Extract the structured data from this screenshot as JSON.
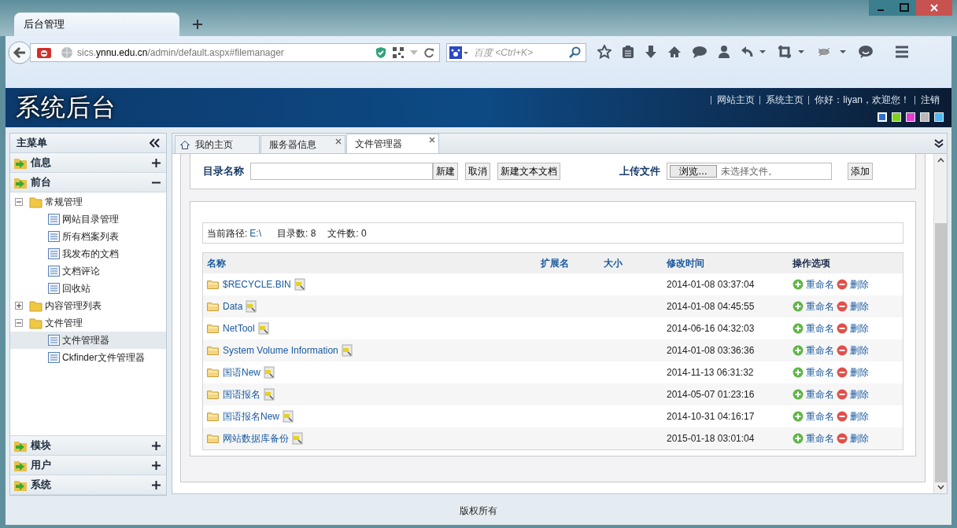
{
  "browser": {
    "tab_title": "后台管理",
    "url": {
      "scheme_host_start": "sics.",
      "host": "ynnu.edu.cn",
      "path": "/admin/default.aspx#filemanager"
    },
    "search_placeholder": "百度 <Ctrl+K>"
  },
  "header": {
    "title": "系统后台",
    "links": [
      "网站主页",
      "系统主页",
      "你好：liyan，欢迎您！",
      "注销"
    ],
    "themes": [
      {
        "color": "#2f6fc8",
        "selected": true
      },
      {
        "color": "#7fd020",
        "selected": false
      },
      {
        "color": "#e040d0",
        "selected": false
      },
      {
        "color": "#b8b8b8",
        "selected": false
      },
      {
        "color": "#50b8f0",
        "selected": false
      }
    ]
  },
  "sidebar": {
    "title": "主菜单",
    "sections": [
      {
        "label": "信息",
        "expanded": false
      },
      {
        "label": "前台",
        "expanded": true,
        "tree": [
          {
            "label": "常规管理",
            "kind": "folder",
            "expanded": true,
            "children": [
              {
                "label": "网站目录管理",
                "kind": "page",
                "selected": false
              },
              {
                "label": "所有档案列表",
                "kind": "page",
                "selected": false
              },
              {
                "label": "我发布的文档",
                "kind": "page",
                "selected": false
              },
              {
                "label": "文档评论",
                "kind": "page",
                "selected": false
              },
              {
                "label": "回收站",
                "kind": "page",
                "selected": false
              }
            ]
          },
          {
            "label": "内容管理列表",
            "kind": "folder",
            "expanded": false
          },
          {
            "label": "文件管理",
            "kind": "folder",
            "expanded": true,
            "children": [
              {
                "label": "文件管理器",
                "kind": "page",
                "selected": true
              },
              {
                "label": "Ckfinder文件管理器",
                "kind": "page",
                "selected": false
              }
            ]
          }
        ]
      },
      {
        "label": "模块",
        "expanded": false
      },
      {
        "label": "用户",
        "expanded": false
      },
      {
        "label": "系统",
        "expanded": false
      }
    ]
  },
  "tabs": [
    {
      "label": "我的主页",
      "kind": "home",
      "selected": false
    },
    {
      "label": "服务器信息",
      "kind": "closable",
      "selected": false
    },
    {
      "label": "文件管理器",
      "kind": "closable",
      "selected": true
    }
  ],
  "form": {
    "dir_label": "目录名称",
    "buttons": [
      "新建",
      "取消",
      "新建文本文档"
    ],
    "upload_label": "上传文件",
    "browse_button": "浏览…",
    "no_file": "未选择文件。",
    "add_button": "添加"
  },
  "info": {
    "path_label": "当前路径:",
    "path": "E:\\",
    "dir_count": "目录数: 8",
    "file_count": "文件数: 0"
  },
  "table": {
    "columns": [
      "名称",
      "扩展名",
      "大小",
      "修改时间",
      "操作选项"
    ],
    "rows": [
      {
        "name": "$RECYCLE.BIN",
        "modified": "2014-01-08 03:37:04",
        "rename": "重命名",
        "delete": "删除"
      },
      {
        "name": "Data",
        "modified": "2014-01-08 04:45:55",
        "rename": "重命名",
        "delete": "删除"
      },
      {
        "name": "NetTool",
        "modified": "2014-06-16 04:32:03",
        "rename": "重命名",
        "delete": "删除"
      },
      {
        "name": "System Volume Information",
        "modified": "2014-01-08 03:36:36",
        "rename": "重命名",
        "delete": "删除"
      },
      {
        "name": "国语New",
        "modified": "2014-11-13 06:31:32",
        "rename": "重命名",
        "delete": "删除"
      },
      {
        "name": "国语报名",
        "modified": "2014-05-07 01:23:16",
        "rename": "重命名",
        "delete": "删除"
      },
      {
        "name": "国语报名New",
        "modified": "2014-10-31 04:16:17",
        "rename": "重命名",
        "delete": "删除"
      },
      {
        "name": "网站数据库备份",
        "modified": "2015-01-18 03:01:04",
        "rename": "重命名",
        "delete": "删除"
      }
    ]
  },
  "footer": "版权所有"
}
